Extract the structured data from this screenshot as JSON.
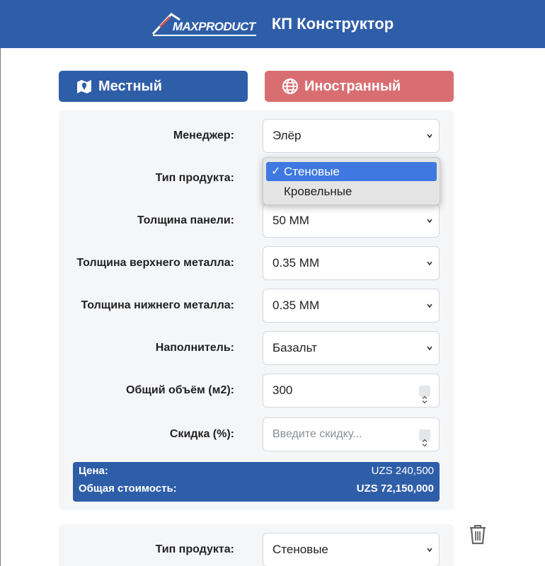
{
  "header": {
    "logo_text": "MAXPRODUCT",
    "title": "КП Конструктор",
    "bg_color": "#2f5ea9"
  },
  "tabs": {
    "local_label": "Местный",
    "local_icon": "map-icon",
    "foreign_label": "Иностранный",
    "foreign_icon": "globe-icon",
    "local_color": "#2f5ea9",
    "foreign_color": "#d96e72"
  },
  "form": {
    "manager_label": "Менеджер:",
    "manager_value": "Элёр",
    "product_type_label": "Тип продукта:",
    "panel_thickness_label": "Толщина панели:",
    "panel_thickness_value": "50 ММ",
    "top_metal_label": "Толщина верхнего металла:",
    "top_metal_value": "0.35 ММ",
    "bottom_metal_label": "Толщина нижнего металла:",
    "bottom_metal_value": "0.35 ММ",
    "filler_label": "Наполнитель:",
    "filler_value": "Базальт",
    "volume_label": "Общий объём (м2):",
    "volume_value": "300",
    "discount_label": "Скидка (%):",
    "discount_placeholder": "Введите скидку..."
  },
  "dropdown": {
    "options": [
      "Стеновые",
      "Кровельные"
    ],
    "selected": "Стеновые"
  },
  "summary": {
    "price_label": "Цена:",
    "price_value": "UZS 240,500",
    "total_label": "Общая стоимость:",
    "total_value": "UZS 72,150,000"
  },
  "card2": {
    "product_type_label": "Тип продукта:",
    "product_type_value": "Стеновые",
    "delete_icon": "trash-icon"
  }
}
